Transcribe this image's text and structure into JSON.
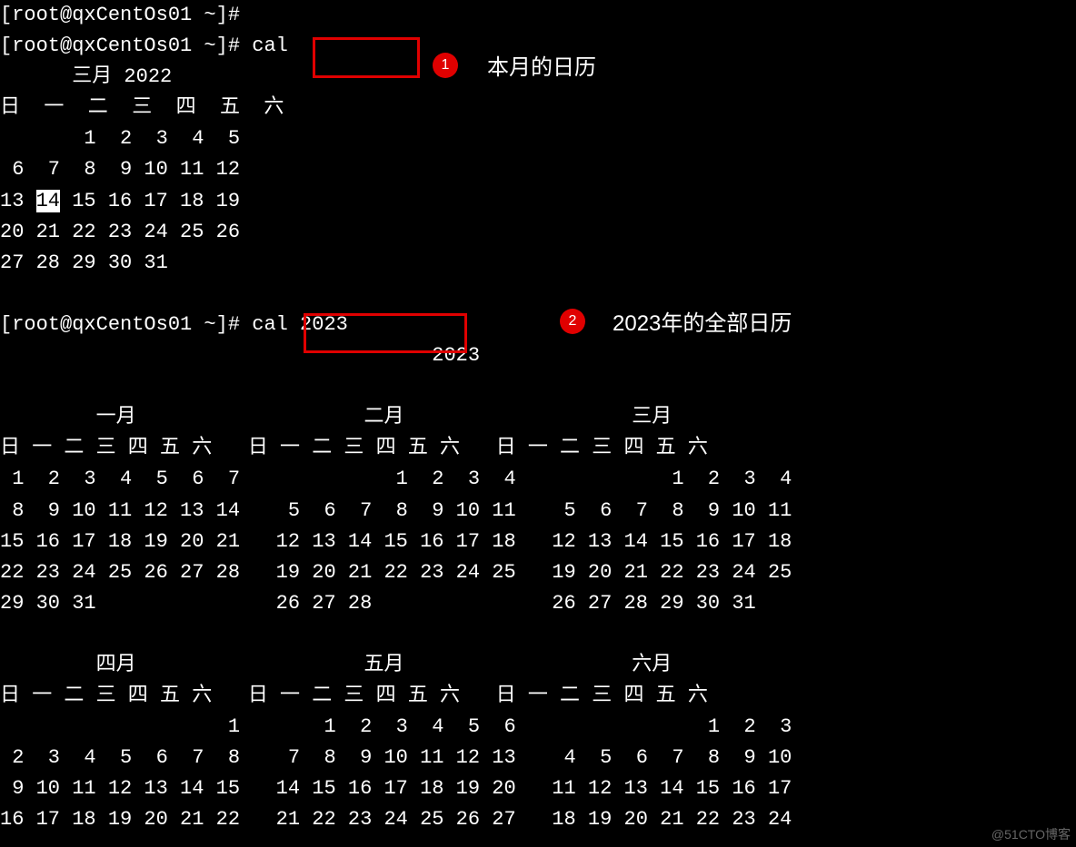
{
  "prompt": "[root@qxCentOs01 ~]# ",
  "cmd1": "cal",
  "cmd2": "cal 2023",
  "annot1": {
    "num": "1",
    "text": "本月的日历"
  },
  "annot2": {
    "num": "2",
    "text": "2023年的全部日历"
  },
  "watermark": "@51CTO博客",
  "month_single": {
    "title": "三月 2022",
    "dow": [
      "日",
      "一",
      "二",
      "三",
      "四",
      "五",
      "六"
    ],
    "weeks": [
      [
        "",
        "",
        "1",
        "2",
        "3",
        "4",
        "5"
      ],
      [
        "6",
        "7",
        "8",
        "9",
        "10",
        "11",
        "12"
      ],
      [
        "13",
        "14",
        "15",
        "16",
        "17",
        "18",
        "19"
      ],
      [
        "20",
        "21",
        "22",
        "23",
        "24",
        "25",
        "26"
      ],
      [
        "27",
        "28",
        "29",
        "30",
        "31",
        "",
        ""
      ]
    ],
    "today": "14"
  },
  "year_title": "2023",
  "year": {
    "row1": [
      {
        "name": "一月",
        "dow": [
          "日",
          "一",
          "二",
          "三",
          "四",
          "五",
          "六"
        ],
        "weeks": [
          [
            "1",
            "2",
            "3",
            "4",
            "5",
            "6",
            "7"
          ],
          [
            "8",
            "9",
            "10",
            "11",
            "12",
            "13",
            "14"
          ],
          [
            "15",
            "16",
            "17",
            "18",
            "19",
            "20",
            "21"
          ],
          [
            "22",
            "23",
            "24",
            "25",
            "26",
            "27",
            "28"
          ],
          [
            "29",
            "30",
            "31",
            "",
            "",
            "",
            ""
          ]
        ]
      },
      {
        "name": "二月",
        "dow": [
          "日",
          "一",
          "二",
          "三",
          "四",
          "五",
          "六"
        ],
        "weeks": [
          [
            "",
            "",
            "",
            "1",
            "2",
            "3",
            "4"
          ],
          [
            "5",
            "6",
            "7",
            "8",
            "9",
            "10",
            "11"
          ],
          [
            "12",
            "13",
            "14",
            "15",
            "16",
            "17",
            "18"
          ],
          [
            "19",
            "20",
            "21",
            "22",
            "23",
            "24",
            "25"
          ],
          [
            "26",
            "27",
            "28",
            "",
            "",
            "",
            ""
          ]
        ]
      },
      {
        "name": "三月",
        "dow": [
          "日",
          "一",
          "二",
          "三",
          "四",
          "五",
          "六"
        ],
        "weeks": [
          [
            "",
            "",
            "",
            "1",
            "2",
            "3",
            "4"
          ],
          [
            "5",
            "6",
            "7",
            "8",
            "9",
            "10",
            "11"
          ],
          [
            "12",
            "13",
            "14",
            "15",
            "16",
            "17",
            "18"
          ],
          [
            "19",
            "20",
            "21",
            "22",
            "23",
            "24",
            "25"
          ],
          [
            "26",
            "27",
            "28",
            "29",
            "30",
            "31",
            ""
          ]
        ]
      }
    ],
    "row2": [
      {
        "name": "四月",
        "dow": [
          "日",
          "一",
          "二",
          "三",
          "四",
          "五",
          "六"
        ],
        "weeks": [
          [
            "",
            "",
            "",
            "",
            "",
            "",
            "1"
          ],
          [
            "2",
            "3",
            "4",
            "5",
            "6",
            "7",
            "8"
          ],
          [
            "9",
            "10",
            "11",
            "12",
            "13",
            "14",
            "15"
          ],
          [
            "16",
            "17",
            "18",
            "19",
            "20",
            "21",
            "22"
          ]
        ]
      },
      {
        "name": "五月",
        "dow": [
          "日",
          "一",
          "二",
          "三",
          "四",
          "五",
          "六"
        ],
        "weeks": [
          [
            "",
            "1",
            "2",
            "3",
            "4",
            "5",
            "6"
          ],
          [
            "7",
            "8",
            "9",
            "10",
            "11",
            "12",
            "13"
          ],
          [
            "14",
            "15",
            "16",
            "17",
            "18",
            "19",
            "20"
          ],
          [
            "21",
            "22",
            "23",
            "24",
            "25",
            "26",
            "27"
          ]
        ]
      },
      {
        "name": "六月",
        "dow": [
          "日",
          "一",
          "二",
          "三",
          "四",
          "五",
          "六"
        ],
        "weeks": [
          [
            "",
            "",
            "",
            "",
            "1",
            "2",
            "3"
          ],
          [
            "4",
            "5",
            "6",
            "7",
            "8",
            "9",
            "10"
          ],
          [
            "11",
            "12",
            "13",
            "14",
            "15",
            "16",
            "17"
          ],
          [
            "18",
            "19",
            "20",
            "21",
            "22",
            "23",
            "24"
          ]
        ]
      }
    ]
  }
}
